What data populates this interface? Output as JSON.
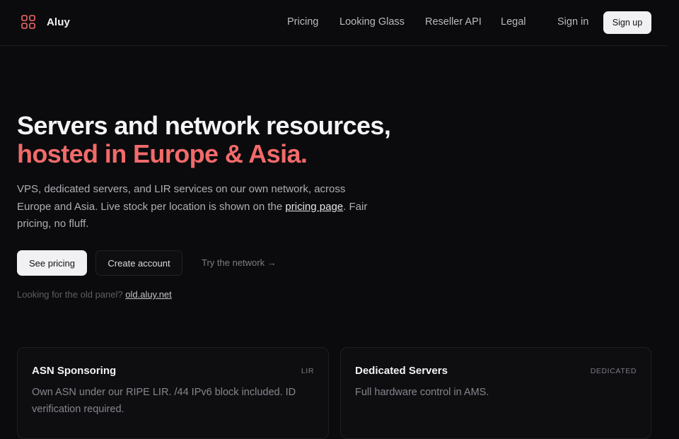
{
  "header": {
    "brand": "Aluy",
    "nav": [
      {
        "label": "Pricing"
      },
      {
        "label": "Looking Glass"
      },
      {
        "label": "Reseller API"
      },
      {
        "label": "Legal"
      }
    ],
    "sign_in": "Sign in",
    "sign_up": "Sign up"
  },
  "hero": {
    "title_line1": "Servers and network resources,",
    "title_line2": "hosted in Europe & Asia.",
    "lead_before": "VPS, dedicated servers, and LIR services on our own network, across Europe and Asia. Live stock per location is shown on the ",
    "lead_link": "pricing page",
    "lead_after": ". Fair pricing, no fluff.",
    "btn_primary": "See pricing",
    "btn_secondary": "Create account",
    "btn_ghost": "Try the network →",
    "old_panel_text": "Looking for the old panel?",
    "old_panel_link": "old.aluy.net"
  },
  "cards": [
    {
      "title": "ASN Sponsoring",
      "tag": "LIR",
      "desc": "Own ASN under our RIPE LIR. /44 IPv6 block included. ID verification required."
    },
    {
      "title": "Dedicated Servers",
      "tag": "DEDICATED",
      "desc": "Full hardware control in AMS."
    }
  ],
  "colors": {
    "background": "#0b0b0d",
    "accent": "#f26a6a",
    "button_light": "#f1f1f3"
  },
  "icons": {
    "logo": "grid-logo-icon"
  }
}
